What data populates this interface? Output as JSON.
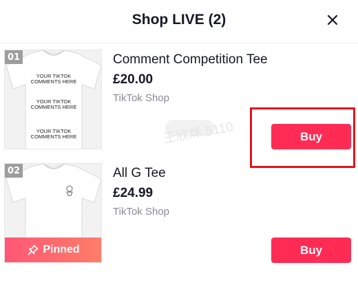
{
  "header": {
    "title": "Shop LIVE (2)"
  },
  "products": [
    {
      "index": "01",
      "name": "Comment Competition Tee",
      "price": "£20.00",
      "shop": "TikTok Shop",
      "buy_label": "Buy",
      "print_lines": [
        "YOUR TIKTOK",
        "COMMENTS HERE",
        "YOUR TIKTOK",
        "COMMENTS HERE",
        "YOUR TIKTOK",
        "COMMENTS HERE"
      ]
    },
    {
      "index": "02",
      "name": "All G Tee",
      "price": "£24.99",
      "shop": "TikTok Shop",
      "buy_label": "Buy",
      "pinned_label": "Pinned"
    }
  ],
  "watermark": "王欣烨 5110",
  "colors": {
    "accent": "#fe2c55",
    "highlight": "#e0141e"
  }
}
